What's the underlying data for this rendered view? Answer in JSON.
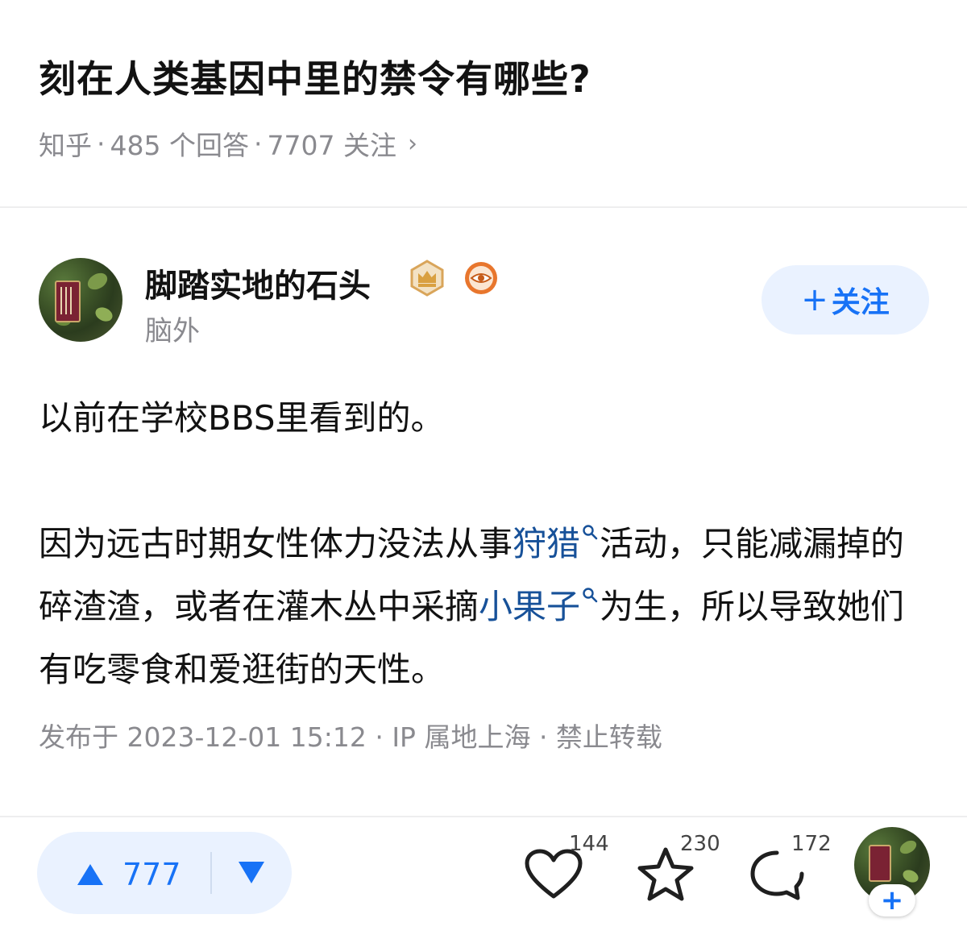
{
  "question": {
    "title": "刻在人类基因中里的禁令有哪些?",
    "source": "知乎",
    "answers": "485 个回答",
    "followers": "7707 关注",
    "chevron": "›"
  },
  "author": {
    "name": "脚踏实地的石头",
    "bio": "脑外",
    "badges": [
      "crown-badge-icon",
      "eye-badge-icon"
    ],
    "follow_label": "关注",
    "follow_plus": "+"
  },
  "answer": {
    "p1": "以前在学校BBS里看到的。",
    "p2_a": "因为远古时期女性体力没法从事",
    "p2_link1": "狩猎",
    "p2_b": "活动，只能减漏掉的碎渣渣，或者在灌木丛中采摘",
    "p2_link2": "小果子",
    "p2_c": "为生，所以导致她们有吃零食和爱逛街的天性。",
    "publish_info": "发布于 2023-12-01 15:12 · IP 属地上海 · 禁止转载"
  },
  "bottom_bar": {
    "upvote_count": "777",
    "like_count": "144",
    "favorite_count": "230",
    "comment_count": "172",
    "avatar_plus": "+"
  },
  "colors": {
    "brand_blue": "#1772f6",
    "link_blue": "#175199",
    "pill_bg": "#eaf2ff",
    "meta_gray": "#8a8a8f"
  }
}
